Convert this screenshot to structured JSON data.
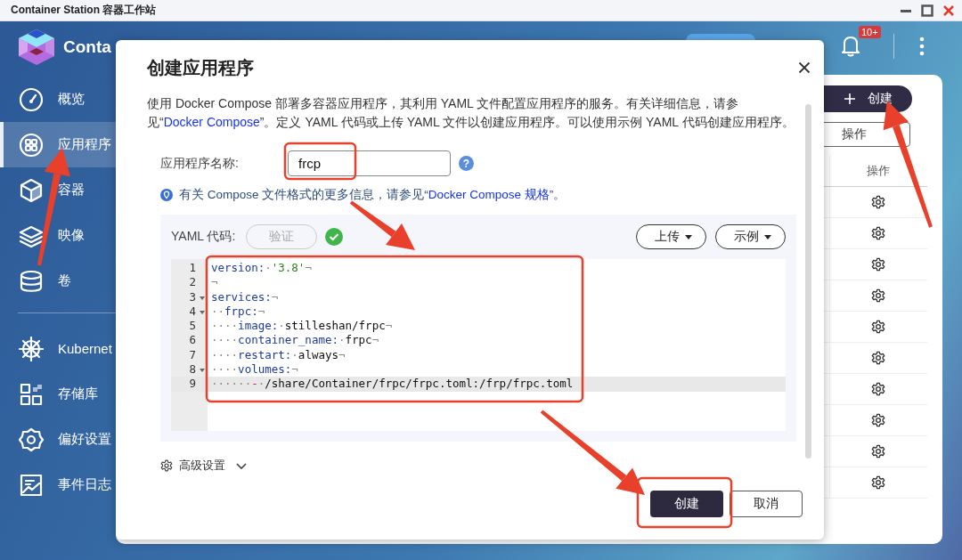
{
  "window": {
    "title": "Container Station 容器工作站"
  },
  "app": {
    "name": "Conta"
  },
  "sidebar": {
    "sections": [
      [
        {
          "label": "概览",
          "selected": false
        },
        {
          "label": "应用程序",
          "selected": true
        },
        {
          "label": "容器",
          "selected": false
        },
        {
          "label": "映像",
          "selected": false
        },
        {
          "label": "卷",
          "selected": false
        }
      ],
      [
        {
          "label": "Kubernet",
          "selected": false
        },
        {
          "label": "存储库",
          "selected": false
        },
        {
          "label": "偏好设置",
          "selected": false
        },
        {
          "label": "事件日志",
          "selected": false
        }
      ]
    ]
  },
  "topbar": {
    "notification_badge": "10+"
  },
  "panel": {
    "create_button": "创建",
    "actions_button": "操作",
    "table": {
      "columns": [
        "操作"
      ],
      "rows": [
        {
          "kind": "settings"
        },
        {
          "kind": "settings"
        },
        {
          "kind": "settings"
        },
        {
          "kind": "settings"
        },
        {
          "kind": "settings"
        },
        {
          "kind": "settings"
        },
        {
          "kind": "settings"
        },
        {
          "kind": "settings"
        },
        {
          "kind": "settings"
        },
        {
          "kind": "settings"
        }
      ]
    }
  },
  "dialog": {
    "title": "创建应用程序",
    "description": [
      {
        "kind": "text",
        "text": "使用 Docker Compose 部署多容器应用程序，其利用 YAML 文件配置应用程序的服务。有关详细信息，请参见“"
      },
      {
        "kind": "link",
        "text": "Docker Compose"
      },
      {
        "kind": "text",
        "text": "”。定义 YAML 代码或上传 YAML 文件以创建应用程序。可以使用示例 YAML 代码创建应用程序。"
      }
    ],
    "name_field": {
      "label": "应用程序名称:",
      "value": "frcp",
      "help": "?"
    },
    "info": [
      {
        "kind": "text",
        "text": "有关 Compose 文件格式的更多信息，请参见“"
      },
      {
        "kind": "link",
        "text": "Docker Compose 规格"
      },
      {
        "kind": "text",
        "text": "”。"
      }
    ],
    "yaml": {
      "label": "YAML 代码:",
      "validate_button": {
        "label": "验证",
        "disabled": true
      },
      "validated": true,
      "upload_button": "上传",
      "example_button": "示例",
      "lines": [
        {
          "number": "1",
          "fold": false,
          "current": false,
          "tokens": [
            {
              "kind": "key",
              "text": "version:"
            },
            {
              "kind": "ws",
              "text": "·"
            },
            {
              "kind": "string",
              "text": "'3.8'"
            },
            {
              "kind": "ws",
              "text": "¬"
            }
          ]
        },
        {
          "number": "2",
          "fold": false,
          "current": false,
          "tokens": [
            {
              "kind": "ws",
              "text": "¬"
            }
          ]
        },
        {
          "number": "3",
          "fold": true,
          "current": false,
          "tokens": [
            {
              "kind": "key",
              "text": "services:"
            },
            {
              "kind": "ws",
              "text": "¬"
            }
          ]
        },
        {
          "number": "4",
          "fold": true,
          "current": false,
          "tokens": [
            {
              "kind": "ws",
              "text": "··"
            },
            {
              "kind": "key",
              "text": "frpc:"
            },
            {
              "kind": "ws",
              "text": "¬"
            }
          ]
        },
        {
          "number": "5",
          "fold": false,
          "current": false,
          "tokens": [
            {
              "kind": "ws",
              "text": "····"
            },
            {
              "kind": "key",
              "text": "image:"
            },
            {
              "kind": "ws",
              "text": "·"
            },
            {
              "kind": "plain",
              "text": "stilleshan/frpc"
            },
            {
              "kind": "ws",
              "text": "¬"
            }
          ]
        },
        {
          "number": "6",
          "fold": false,
          "current": false,
          "tokens": [
            {
              "kind": "ws",
              "text": "····"
            },
            {
              "kind": "key",
              "text": "container_name:"
            },
            {
              "kind": "ws",
              "text": "·"
            },
            {
              "kind": "plain",
              "text": "frpc"
            },
            {
              "kind": "ws",
              "text": "¬"
            }
          ]
        },
        {
          "number": "7",
          "fold": false,
          "current": false,
          "tokens": [
            {
              "kind": "ws",
              "text": "····"
            },
            {
              "kind": "key",
              "text": "restart:"
            },
            {
              "kind": "ws",
              "text": "·"
            },
            {
              "kind": "plain",
              "text": "always"
            },
            {
              "kind": "ws",
              "text": "¬"
            }
          ]
        },
        {
          "number": "8",
          "fold": true,
          "current": false,
          "tokens": [
            {
              "kind": "ws",
              "text": "····"
            },
            {
              "kind": "key",
              "text": "volumes:"
            },
            {
              "kind": "ws",
              "text": "¬"
            }
          ]
        },
        {
          "number": "9",
          "fold": false,
          "current": true,
          "tokens": [
            {
              "kind": "ws",
              "text": "······"
            },
            {
              "kind": "dash",
              "text": "-"
            },
            {
              "kind": "ws",
              "text": "·"
            },
            {
              "kind": "plain",
              "text": "/share/Container/frpc/frpc.toml:/frp/frpc.toml"
            }
          ]
        }
      ]
    },
    "advanced": {
      "label": "高级设置",
      "expanded": false
    },
    "buttons": [
      {
        "label": "创建",
        "kind": "primary"
      },
      {
        "label": "取消",
        "kind": "secondary"
      }
    ]
  }
}
